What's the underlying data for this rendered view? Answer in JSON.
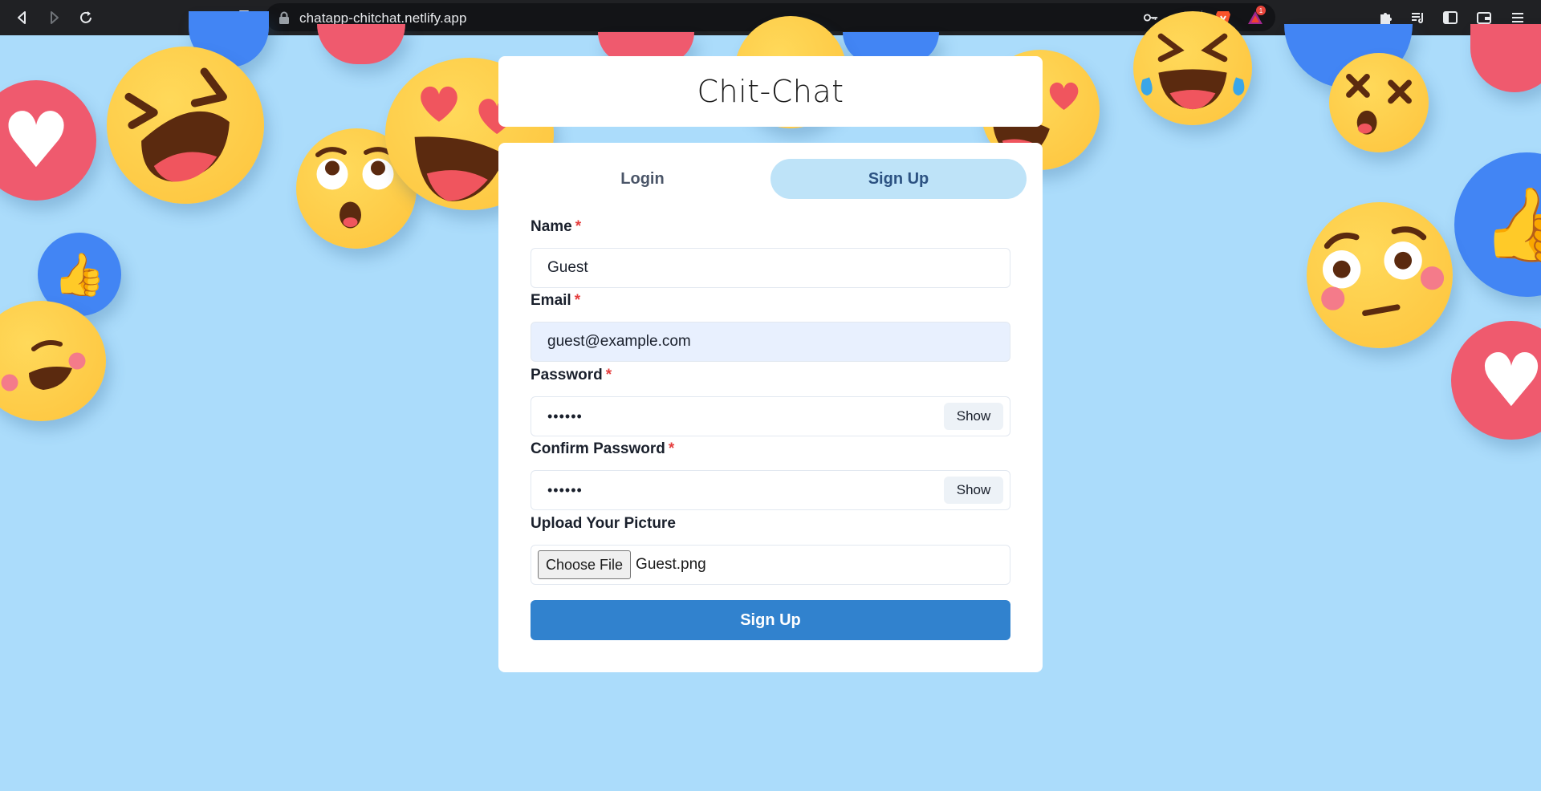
{
  "browser": {
    "url": "chatapp-chitchat.netlify.app",
    "extension_badge": "1"
  },
  "header": {
    "title": "Chit-Chat"
  },
  "tabs": [
    {
      "label": "Login",
      "active": false
    },
    {
      "label": "Sign Up",
      "active": true
    }
  ],
  "form": {
    "name_label": "Name",
    "name_value": "Guest",
    "email_label": "Email",
    "email_value": "guest@example.com",
    "password_label": "Password",
    "password_value": "••••••",
    "confirm_password_label": "Confirm Password",
    "confirm_password_value": "••••••",
    "show_label": "Show",
    "upload_label": "Upload Your Picture",
    "choose_file_label": "Choose File",
    "file_name": "Guest.png",
    "required_marker": "*",
    "submit_label": "Sign Up"
  },
  "colors": {
    "page_background": "#abdcfb",
    "active_tab_bg": "#bee3f8",
    "submit_bg": "#3182ce",
    "required": "#e53e3e",
    "autofill_bg": "#e8f0fe"
  }
}
